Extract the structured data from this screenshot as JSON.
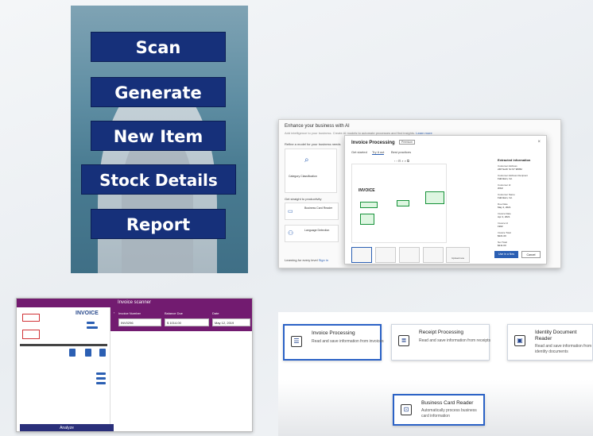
{
  "mobile_menu": {
    "buttons": [
      "Scan",
      "Generate",
      "New Item",
      "Stock Details",
      "Report"
    ]
  },
  "ai_builder": {
    "heading": "Enhance your business with AI",
    "subheading": "Add intelligence to your business. Create AI models to automate processes and find insights.",
    "learn_more": "Learn more",
    "refine": "Refine a model for your business needs",
    "category_title": "Category Classification",
    "get_straight": "Get straight to productivity",
    "business_card": "Business Card Reader",
    "language_detection": "Language Detection",
    "learning": "Learning for every level",
    "sign_in": "Sign in",
    "dialog": {
      "title": "Invoice Processing",
      "badge": "Premium",
      "close": "×",
      "tabs": [
        "Get started",
        "Try it out",
        "Best practices"
      ],
      "invoice_word": "INVOICE",
      "extracted_title": "Extracted information",
      "fields": [
        {
          "label": "Customer Address",
          "value": "248 North St NY 98052"
        },
        {
          "label": "Customer Address Recipient",
          "value": "Fabrikam, Inc."
        },
        {
          "label": "Customer Id",
          "value": "WKZ"
        },
        {
          "label": "Customer Name",
          "value": "Fabrikam, Inc."
        },
        {
          "label": "Due Date",
          "value": "May 4, 2021"
        },
        {
          "label": "Invoice Date",
          "value": "Apr 4, 2021"
        },
        {
          "label": "Invoice Id",
          "value": "1902"
        },
        {
          "label": "Invoice Total",
          "value": "$221.00"
        },
        {
          "label": "Net Total",
          "value": "$211.00"
        }
      ],
      "upload_label": "Upload new",
      "use_button": "Use in a flow",
      "cancel_button": "Cancel"
    }
  },
  "invoice_scanner": {
    "title": "Invoice scanner",
    "invoice_heading": "INVOICE",
    "labels": {
      "invoice_number": "Invoice Number",
      "balance_due": "Balance Due",
      "date": "Date"
    },
    "values": {
      "invoice_number": "INV0296",
      "balance_due": "$ 1014.00",
      "date": "May 12, 2019"
    },
    "analyze_button": "Analyze"
  },
  "model_cards": [
    {
      "title": "Invoice Processing",
      "description": "Read and save information from invoices",
      "icon": "invoice-icon"
    },
    {
      "title": "Receipt Processing",
      "description": "Read and save information from receipts",
      "icon": "receipt-icon"
    },
    {
      "title": "Identity Document Reader",
      "description": "Read and save information from identity documents",
      "icon": "id-card-icon"
    },
    {
      "title": "Business Card Reader",
      "description": "Automatically process business card information",
      "icon": "business-card-icon"
    }
  ],
  "colors": {
    "navy_button": "#16307a",
    "purple_bar": "#721b70",
    "accent_blue": "#2b62c6",
    "highlight_green": "#17923a"
  }
}
